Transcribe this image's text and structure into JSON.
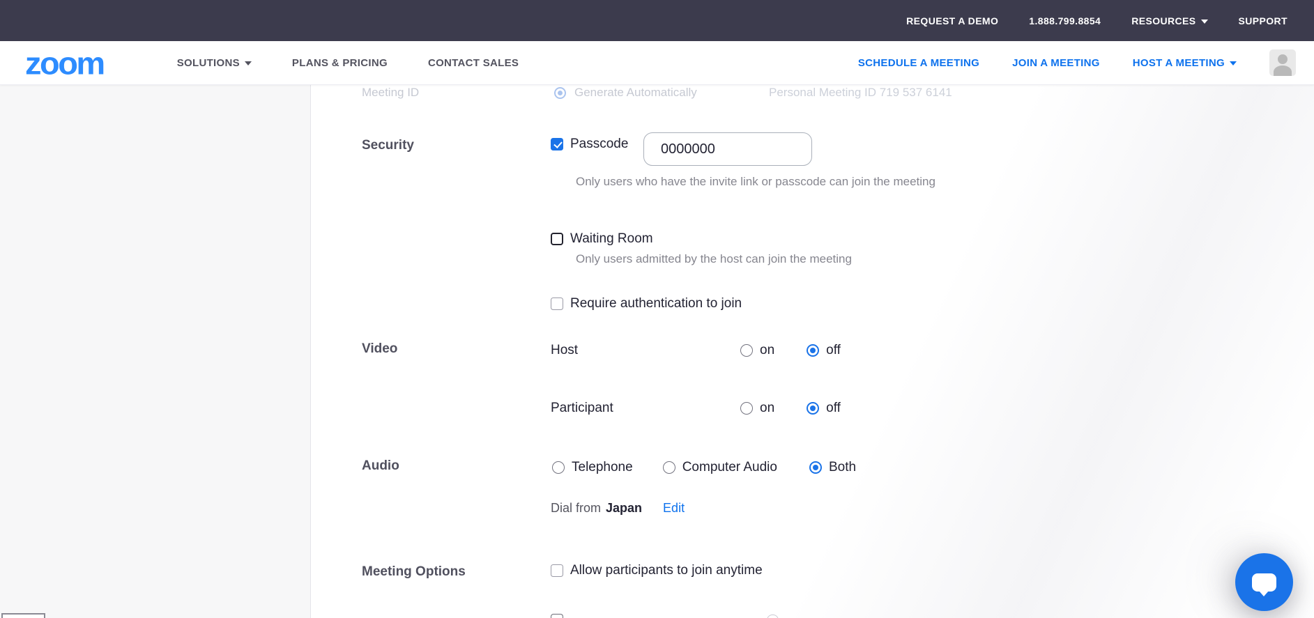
{
  "topbar": {
    "items": [
      "REQUEST A DEMO",
      "1.888.799.8854",
      "RESOURCES",
      "SUPPORT"
    ]
  },
  "navbar": {
    "logo": "zoom",
    "left_items": [
      "SOLUTIONS",
      "PLANS & PRICING",
      "CONTACT SALES"
    ],
    "right_items": [
      "SCHEDULE A MEETING",
      "JOIN A MEETING",
      "HOST A MEETING"
    ]
  },
  "hidden_row": {
    "meeting_id_label": "Meeting ID",
    "generate_option": "Generate Automatically",
    "pmi_option": "Personal Meeting ID 719 537 6141"
  },
  "form": {
    "security": {
      "section_label": "Security",
      "passcode_label": "Passcode",
      "passcode_value": "0000000",
      "passcode_helper": "Only users who have the invite link or passcode can join the meeting",
      "waiting_room_label": "Waiting Room",
      "waiting_room_helper": "Only users admitted by the host can join the meeting",
      "require_auth_label": "Require authentication to join"
    },
    "video": {
      "section_label": "Video",
      "host_label": "Host",
      "participant_label": "Participant",
      "on_label": "on",
      "off_label": "off",
      "host_value": "off",
      "participant_value": "off"
    },
    "audio": {
      "section_label": "Audio",
      "options": [
        "Telephone",
        "Computer Audio",
        "Both"
      ],
      "selected": "Both",
      "dial_from_prefix": "Dial from",
      "dial_from_country": "Japan",
      "edit_label": "Edit"
    },
    "meeting_options": {
      "section_label": "Meeting Options",
      "join_anytime_label": "Allow participants to join anytime"
    }
  },
  "colors": {
    "topbar_bg": "#3c3b4d",
    "brand_blue": "#2D8CFF",
    "link_blue": "#0e72ed",
    "control_blue": "#1a73e8",
    "rail_bg": "#f7f7f8"
  }
}
